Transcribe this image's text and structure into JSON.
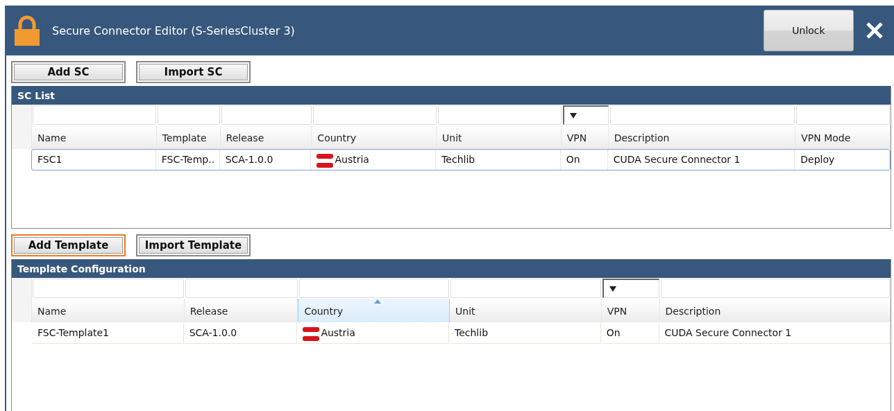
{
  "window": {
    "title": "Secure Connector Editor (S-SeriesCluster 3)",
    "unlock_button": "Unlock"
  },
  "sc_buttons": [
    {
      "label": "Add SC",
      "highlighted": false
    },
    {
      "label": "Import SC",
      "highlighted": false
    }
  ],
  "sc_list": {
    "title": "SC List",
    "columns": [
      {
        "label": "Name",
        "dropdown_filter": false,
        "kind": "text",
        "sorted": false
      },
      {
        "label": "Template",
        "dropdown_filter": false,
        "kind": "text",
        "sorted": false
      },
      {
        "label": "Release",
        "dropdown_filter": false,
        "kind": "text",
        "sorted": false
      },
      {
        "label": "Country",
        "dropdown_filter": false,
        "kind": "flag",
        "sorted": false
      },
      {
        "label": "Unit",
        "dropdown_filter": false,
        "kind": "text",
        "sorted": false
      },
      {
        "label": "VPN",
        "dropdown_filter": true,
        "kind": "text",
        "sorted": false
      },
      {
        "label": "Description",
        "dropdown_filter": false,
        "kind": "text",
        "sorted": false
      },
      {
        "label": "VPN Mode",
        "dropdown_filter": false,
        "kind": "text",
        "sorted": false
      }
    ],
    "rows": [
      {
        "selected": true,
        "cells": [
          "FSC1",
          "FSC-Temp..",
          "SCA-1.0.0",
          "Austria",
          "Techlib",
          "On",
          "CUDA Secure Connector 1",
          "Deploy"
        ]
      }
    ]
  },
  "template_buttons": [
    {
      "label": "Add Template",
      "highlighted": true
    },
    {
      "label": "Import Template",
      "highlighted": false
    }
  ],
  "template_configuration": {
    "title": "Template Configuration",
    "columns": [
      {
        "label": "Name",
        "dropdown_filter": false,
        "kind": "text",
        "sorted": false
      },
      {
        "label": "Release",
        "dropdown_filter": false,
        "kind": "text",
        "sorted": false
      },
      {
        "label": "Country",
        "dropdown_filter": false,
        "kind": "flag",
        "sorted": true
      },
      {
        "label": "Unit",
        "dropdown_filter": false,
        "kind": "text",
        "sorted": false
      },
      {
        "label": "VPN",
        "dropdown_filter": true,
        "kind": "text",
        "sorted": false
      },
      {
        "label": "Description",
        "dropdown_filter": false,
        "kind": "text",
        "sorted": false
      }
    ],
    "rows": [
      {
        "selected": false,
        "cells": [
          "FSC-Template1",
          "SCA-1.0.0",
          "Austria",
          "Techlib",
          "On",
          "CUDA Secure Connector 1"
        ]
      }
    ]
  }
}
